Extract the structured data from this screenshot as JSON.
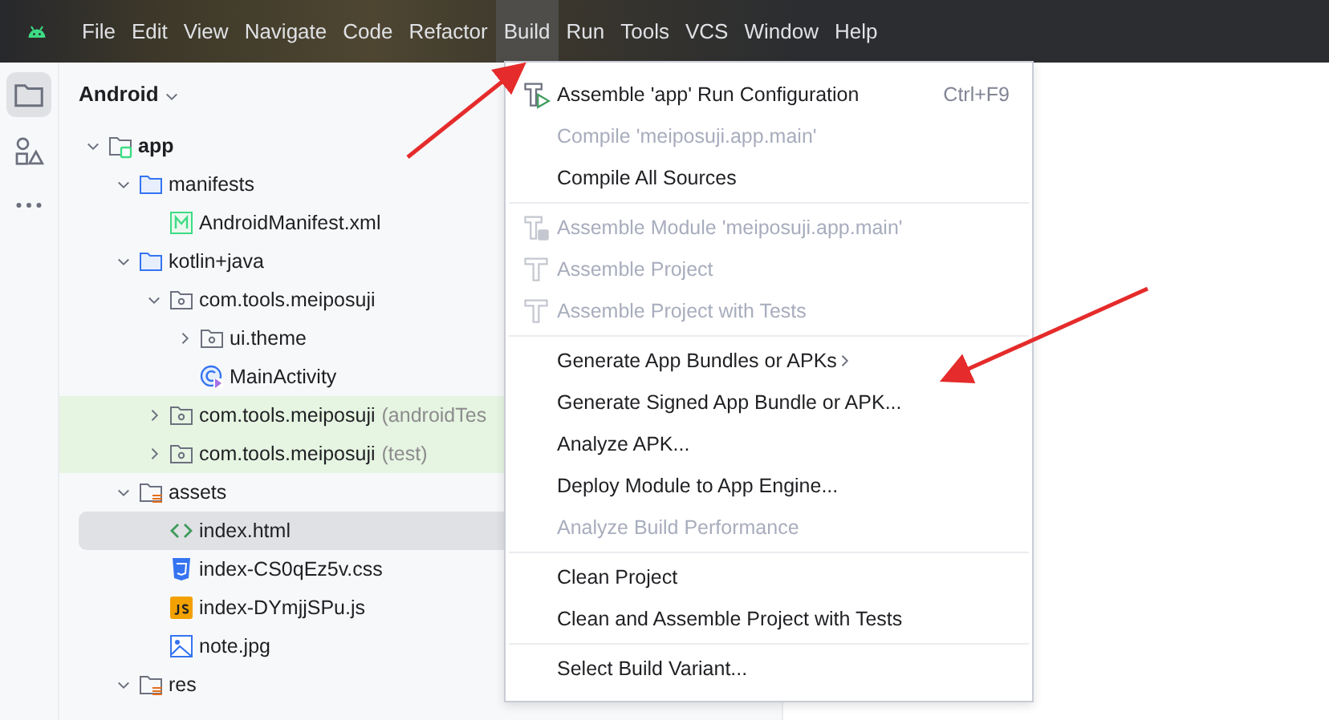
{
  "menu_bar": [
    {
      "label": "File",
      "selected": false
    },
    {
      "label": "Edit",
      "selected": false
    },
    {
      "label": "View",
      "selected": false
    },
    {
      "label": "Navigate",
      "selected": false
    },
    {
      "label": "Code",
      "selected": false
    },
    {
      "label": "Refactor",
      "selected": false
    },
    {
      "label": "Build",
      "selected": true
    },
    {
      "label": "Run",
      "selected": false
    },
    {
      "label": "Tools",
      "selected": false
    },
    {
      "label": "VCS",
      "selected": false
    },
    {
      "label": "Window",
      "selected": false
    },
    {
      "label": "Help",
      "selected": false
    }
  ],
  "tool_strip": [
    {
      "kind": "folder",
      "selected": true
    },
    {
      "kind": "shapes",
      "selected": false
    },
    {
      "kind": "more",
      "selected": false
    }
  ],
  "project_panel": {
    "view": "Android",
    "tree": [
      {
        "label": "app",
        "kind": "module",
        "expanded": true,
        "selected": false,
        "tinted": false,
        "children": [
          {
            "label": "manifests",
            "kind": "folder",
            "expanded": true,
            "selected": false,
            "tinted": false,
            "children": [
              {
                "label": "AndroidManifest.xml",
                "kind": "manifest",
                "selected": false,
                "tinted": false
              }
            ]
          },
          {
            "label": "kotlin+java",
            "kind": "folder",
            "expanded": true,
            "selected": false,
            "tinted": false,
            "children": [
              {
                "label": "com.tools.meiposuji",
                "kind": "package",
                "expanded": true,
                "selected": false,
                "tinted": false,
                "children": [
                  {
                    "label": "ui.theme",
                    "kind": "package",
                    "expanded": false,
                    "selected": false,
                    "tinted": false
                  },
                  {
                    "label": "MainActivity",
                    "kind": "class",
                    "selected": false,
                    "tinted": false
                  }
                ]
              },
              {
                "label": "com.tools.meiposuji",
                "suffix": "(androidTes",
                "kind": "package",
                "expanded": false,
                "selected": false,
                "tinted": true
              },
              {
                "label": "com.tools.meiposuji",
                "suffix": "(test)",
                "kind": "package",
                "expanded": false,
                "selected": false,
                "tinted": true
              }
            ]
          },
          {
            "label": "assets",
            "kind": "resfolder",
            "expanded": true,
            "selected": false,
            "tinted": false,
            "children": [
              {
                "label": "index.html",
                "kind": "html",
                "selected": true,
                "tinted": false
              },
              {
                "label": "index-CS0qEz5v.css",
                "kind": "css",
                "selected": false,
                "tinted": false
              },
              {
                "label": "index-DYmjjSPu.js",
                "kind": "js",
                "selected": false,
                "tinted": false
              },
              {
                "label": "note.jpg",
                "kind": "image",
                "selected": false,
                "tinted": false
              }
            ]
          },
          {
            "label": "res",
            "kind": "resfolder",
            "expanded": true,
            "selected": false,
            "tinted": false
          }
        ]
      }
    ]
  },
  "build_menu": [
    {
      "kind": "run-build",
      "label": "Assemble 'app' Run Configuration",
      "shortcut": "Ctrl+F9",
      "disabled": false
    },
    {
      "kind": "item",
      "label": "Compile 'meiposuji.app.main'",
      "disabled": true
    },
    {
      "kind": "item",
      "label": "Compile All Sources",
      "disabled": false
    },
    {
      "kind": "separator"
    },
    {
      "kind": "module-build",
      "label": "Assemble Module 'meiposuji.app.main'",
      "disabled": true
    },
    {
      "kind": "build",
      "label": "Assemble Project",
      "disabled": true
    },
    {
      "kind": "build",
      "label": "Assemble Project with Tests",
      "disabled": true
    },
    {
      "kind": "separator"
    },
    {
      "kind": "item",
      "label": "Generate App Bundles or APKs",
      "submenu": true,
      "disabled": false
    },
    {
      "kind": "item",
      "label": "Generate Signed App Bundle or APK...",
      "disabled": false
    },
    {
      "kind": "item",
      "label": "Analyze APK...",
      "disabled": false
    },
    {
      "kind": "item",
      "label": "Deploy Module to App Engine...",
      "disabled": false
    },
    {
      "kind": "item",
      "label": "Analyze Build Performance",
      "disabled": true
    },
    {
      "kind": "separator"
    },
    {
      "kind": "item",
      "label": "Clean Project",
      "disabled": false
    },
    {
      "kind": "item",
      "label": "Clean and Assemble Project with Tests",
      "disabled": false
    },
    {
      "kind": "separator"
    },
    {
      "kind": "item",
      "label": "Select Build Variant...",
      "disabled": false
    }
  ]
}
